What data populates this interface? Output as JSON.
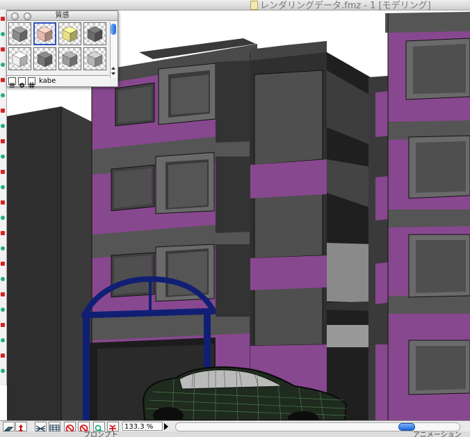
{
  "main_window": {
    "title": "レンダリングデータ.fmz - 1 [モデリング]"
  },
  "palette": {
    "title": "質感",
    "selected_material": "kabe",
    "swatches": [
      {
        "name": "gray-cube",
        "color": "#8a8a8a",
        "selected": false
      },
      {
        "name": "pink-cube",
        "color": "#e7b8ae",
        "selected": true
      },
      {
        "name": "yellow-cube",
        "color": "#e8df85",
        "selected": false
      },
      {
        "name": "dark-gray-cube",
        "color": "#6a6a6a",
        "selected": false
      },
      {
        "name": "white-cube",
        "color": "#f0f0f0",
        "selected": false
      },
      {
        "name": "stone-cube",
        "color": "#777777",
        "selected": false
      },
      {
        "name": "mid-gray-cube",
        "color": "#9a9a9a",
        "selected": false
      },
      {
        "name": "light-gray-cube",
        "color": "#b5b5b5",
        "selected": false
      }
    ]
  },
  "statusbar": {
    "zoom": "133.3 %"
  },
  "bottom_labels": {
    "left": "プロンプト",
    "right": "アニメーション"
  },
  "colors": {
    "wall_purple": "#88488f",
    "dark": "#2e2e2e",
    "gray": "#555555",
    "window": "#4f4f4f",
    "arch": "#101f74",
    "car_body": "#1f2b1f",
    "car_wire": "#4a7a4a",
    "accent_blue": "#1c64d6"
  },
  "icons": {
    "statusbar": [
      "view-plane-icon",
      "axis-arrows-icon",
      "grid-toggle-icon",
      "table-icon",
      "no-entry-icon",
      "no-entry-icon",
      "magnifier-icon",
      "axis-icon"
    ],
    "palette_bottom": [
      "list-icon",
      "gear-icon",
      "grid-icon"
    ]
  }
}
